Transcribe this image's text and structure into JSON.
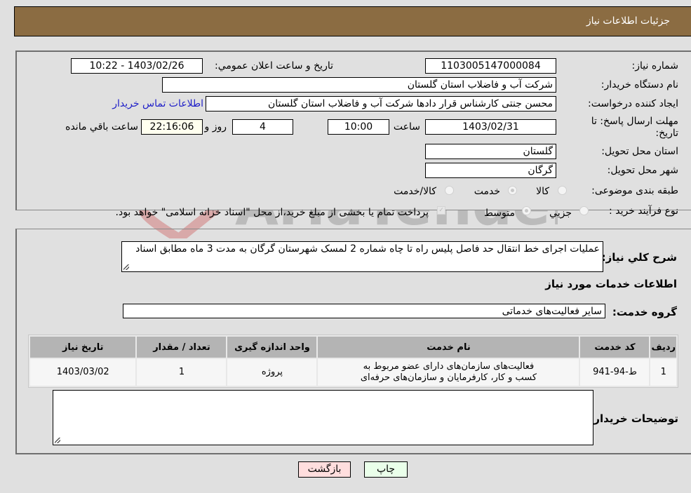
{
  "header": {
    "title": "جزئیات اطلاعات نیاز"
  },
  "fields": {
    "need_number_label": "شماره نیاز:",
    "need_number": "1103005147000084",
    "announce_label": "تاریخ و ساعت اعلان عمومي:",
    "announce_value": "1403/02/26 - 10:22",
    "buyer_org_label": "نام دستگاه خریدار:",
    "buyer_org": "شرکت آب و فاضلاب استان گلستان",
    "creator_label": "ایجاد کننده درخواست:",
    "creator": "محسن جنتی کارشناس قرار دادها شرکت آب و فاضلاب استان گلستان",
    "contact_link": "اطلاعات تماس خریدار",
    "deadline_label_line1": "مهلت ارسال پاسخ: تا",
    "deadline_label_line2": "تاریخ:",
    "deadline_date": "1403/02/31",
    "time_label": "ساعت",
    "deadline_time": "10:00",
    "days": "4",
    "days_label": "روز و",
    "remaining_time": "22:16:06",
    "remaining_label": "ساعت باقي مانده",
    "province_label": "استان محل تحویل:",
    "province": "گلستان",
    "city_label": "شهر محل تحویل:",
    "city": "گرگان",
    "category_label": "طبقه بندی موضوعی:",
    "category_options": [
      "کالا",
      "خدمت",
      "کالا/خدمت"
    ],
    "category_selected": "خدمت",
    "process_label": "نوع فرآیند خرید :",
    "process_options": [
      "جزیي",
      "متوسط"
    ],
    "process_selected": "متوسط",
    "treasury_note": "پرداخت تمام یا بخشی از مبلغ خرید،از محل \"اسناد خزانه اسلامی\" خواهد بود.",
    "treasury_checked": true
  },
  "description": {
    "label": "شرح کلي نیاز:",
    "text": "عملیات اجرای خط انتقال حد فاصل پلیس راه تا چاه شماره 2 لمسک شهرستان گرگان به مدت 3 ماه مطابق اسناد"
  },
  "services": {
    "section_title": "اطلاعات خدمات مورد نیاز",
    "group_label": "گروه خدمت:",
    "group_value": "سایر فعالیت‌های خدماتی",
    "columns": [
      "ردیف",
      "کد خدمت",
      "نام خدمت",
      "واحد اندازه گیری",
      "تعداد / مقدار",
      "تاریخ نیاز"
    ],
    "rows": [
      {
        "index": "1",
        "code": "ط-94-941",
        "name": "فعالیت‌های سازمان‌های دارای عضو مربوط به کسب و کار، کارفرمایان و سازمان‌های حرفه‌ای",
        "unit": "پروژه",
        "quantity": "1",
        "date": "1403/03/02"
      }
    ]
  },
  "buyer_notes": {
    "label": "توضیحات خریدار:",
    "value": ""
  },
  "buttons": {
    "print": "چاپ",
    "back": "بازگشت"
  },
  "colors": {
    "header_bg": "#8b6c42",
    "print_bg": "#eaffea",
    "back_bg": "#ffdede",
    "link": "#2020c8"
  },
  "watermark": {
    "text": "AriaTender.neT"
  }
}
